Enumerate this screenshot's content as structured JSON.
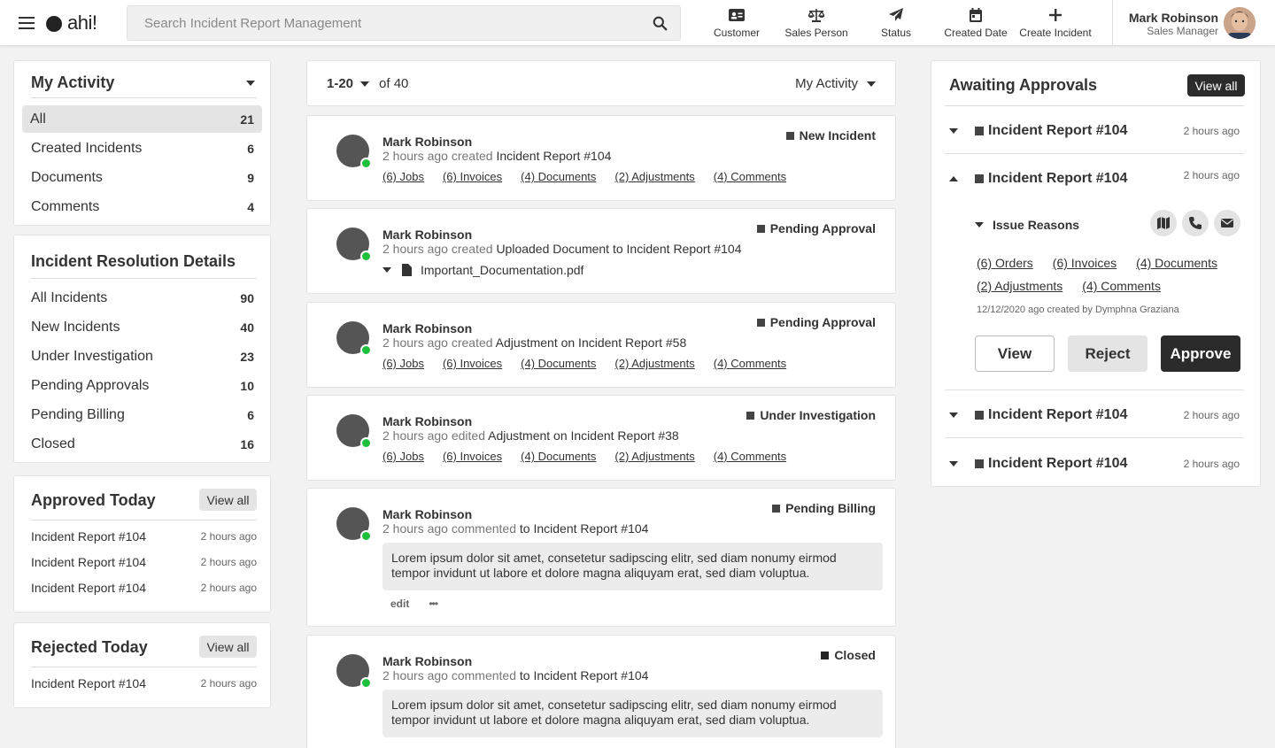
{
  "app": {
    "logo_text": "ahi!",
    "search_placeholder": "Search Incident Report Management"
  },
  "nav": [
    {
      "label": "Customer",
      "icon": "id-card-icon"
    },
    {
      "label": "Sales Person",
      "icon": "scale-icon"
    },
    {
      "label": "Status",
      "icon": "paper-plane-icon"
    },
    {
      "label": "Created Date",
      "icon": "calendar-icon"
    },
    {
      "label": "Create Incident",
      "icon": "plus-icon"
    }
  ],
  "user": {
    "name": "Mark Robinson",
    "role": "Sales Manager"
  },
  "my_activity": {
    "title": "My Activity",
    "items": [
      {
        "label": "All",
        "count": "21"
      },
      {
        "label": "Created Incidents",
        "count": "6"
      },
      {
        "label": "Documents",
        "count": "9"
      },
      {
        "label": "Comments",
        "count": "4"
      }
    ]
  },
  "resolution": {
    "title": "Incident Resolution Details",
    "items": [
      {
        "label": "All Incidents",
        "count": "90"
      },
      {
        "label": "New Incidents",
        "count": "40"
      },
      {
        "label": "Under Investigation",
        "count": "23"
      },
      {
        "label": "Pending Approvals",
        "count": "10"
      },
      {
        "label": "Pending Billing",
        "count": "6"
      },
      {
        "label": "Closed",
        "count": "16"
      }
    ]
  },
  "approved_today": {
    "title": "Approved Today",
    "view_all": "View all",
    "items": [
      {
        "label": "Incident Report #104",
        "time": "2 hours ago"
      },
      {
        "label": "Incident Report #104",
        "time": "2 hours ago"
      },
      {
        "label": "Incident Report #104",
        "time": "2 hours ago"
      }
    ]
  },
  "rejected_today": {
    "title": "Rejected Today",
    "view_all": "View all",
    "items": [
      {
        "label": "Incident Report #104",
        "time": "2 hours ago"
      }
    ]
  },
  "feed": {
    "range": "1-20",
    "of": "of 40",
    "filter": "My Activity",
    "cards": [
      {
        "name": "Mark Robinson",
        "time": "2 hours ago",
        "verb": "created",
        "target": "Incident Report #104",
        "status": "New Incident",
        "links": [
          "(6) Jobs",
          "(6) Invoices",
          "(4) Documents",
          "(2) Adjustments",
          "(4) Comments"
        ]
      },
      {
        "name": "Mark Robinson",
        "time": "2 hours ago",
        "verb": "created",
        "target": "Uploaded Document to Incident Report #104",
        "status": "Pending Approval",
        "file": "Important_Documentation.pdf"
      },
      {
        "name": "Mark Robinson",
        "time": "2 hours ago",
        "verb": "created",
        "target": "Adjustment on Incident Report #58",
        "status": "Pending Approval",
        "links": [
          "(6) Jobs",
          "(6) Invoices",
          "(4) Documents",
          "(2) Adjustments",
          "(4) Comments"
        ]
      },
      {
        "name": "Mark Robinson",
        "time": "2 hours ago",
        "verb": "edited",
        "target": "Adjustment on Incident Report #38",
        "status": "Under Investigation",
        "links": [
          "(6) Jobs",
          "(6) Invoices",
          "(4) Documents",
          "(2) Adjustments",
          "(4) Comments"
        ]
      },
      {
        "name": "Mark Robinson",
        "time": "2 hours ago",
        "verb": "commented",
        "target": "to Incident Report #104",
        "status": "Pending Billing",
        "comment": "Lorem ipsum dolor sit amet, consetetur sadipscing elitr, sed diam nonumy eirmod tempor invidunt ut labore et dolore magna aliquyam erat, sed diam voluptua.",
        "edit": "edit",
        "more": "•••"
      },
      {
        "name": "Mark Robinson",
        "time": "2 hours ago",
        "verb": "commented",
        "target": "to Incident Report #104",
        "status": "Closed",
        "comment": "Lorem ipsum dolor sit amet, consetetur sadipscing elitr, sed diam nonumy eirmod tempor invidunt ut labore et dolore magna aliquyam erat, sed diam voluptua."
      }
    ]
  },
  "awaiting": {
    "title": "Awaiting Approvals",
    "view_all": "View all",
    "items": [
      {
        "title": "Incident Report #104",
        "time": "2 hours ago"
      },
      {
        "title": "Incident Report #104",
        "time": "2 hours ago"
      },
      {
        "title": "Incident Report #104",
        "time": "2 hours ago"
      },
      {
        "title": "Incident Report #104",
        "time": "2 hours ago"
      }
    ],
    "expanded": {
      "section": "Issue Reasons",
      "links": [
        "(6) Orders",
        "(6) Invoices",
        "(4) Documents",
        "(2) Adjustments",
        "(4) Comments"
      ],
      "meta": "12/12/2020 ago created by Dymphna Graziana",
      "view": "View",
      "reject": "Reject",
      "approve": "Approve"
    }
  }
}
